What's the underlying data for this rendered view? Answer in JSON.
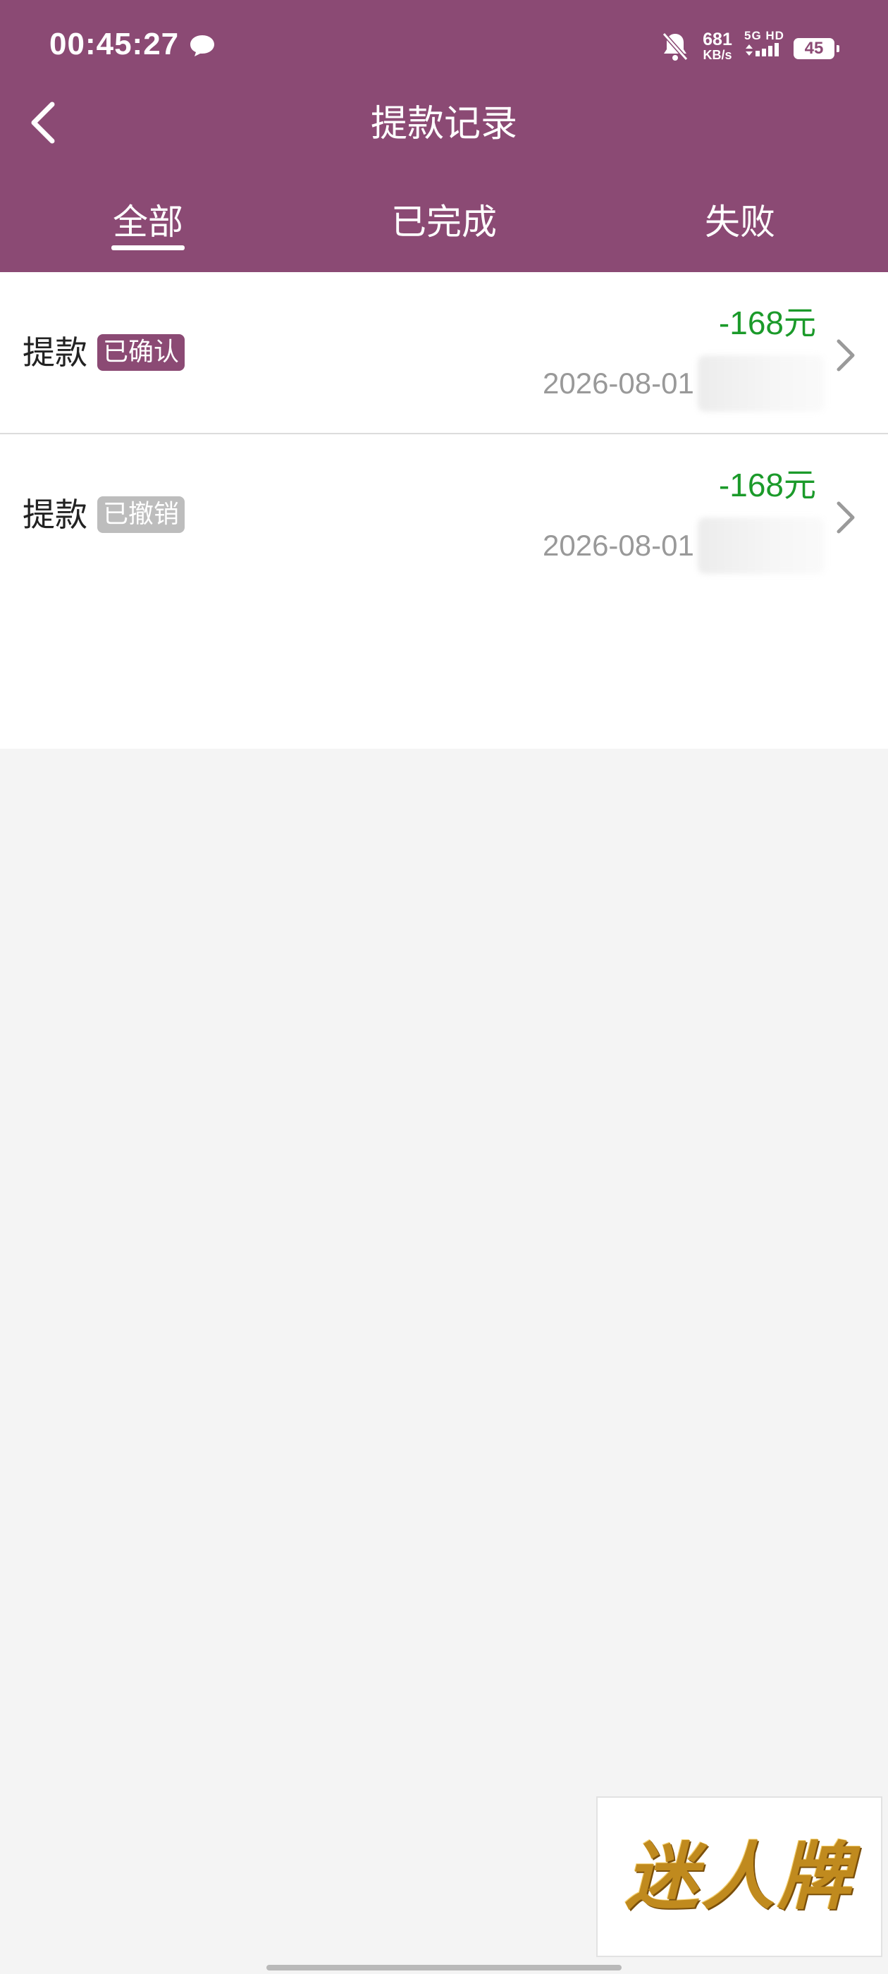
{
  "colors": {
    "accent": "#8b4a74",
    "amount_green": "#1b9a2a",
    "badge_cancelled": "#bdbdbd"
  },
  "status_bar": {
    "time": "00:45:27",
    "net_speed_value": "681",
    "net_speed_unit": "KB/s",
    "signal_label": "5G HD",
    "battery": "45"
  },
  "header": {
    "title": "提款记录"
  },
  "tabs": [
    {
      "label": "全部",
      "active": true
    },
    {
      "label": "已完成",
      "active": false
    },
    {
      "label": "失败",
      "active": false
    }
  ],
  "records": [
    {
      "kind": "提款",
      "status": "已确认",
      "amount": "-168元",
      "date": "2026-08-01"
    },
    {
      "kind": "提款",
      "status": "已撤销",
      "amount": "-168元",
      "date": "2026-08-01"
    }
  ],
  "logo": {
    "text": "迷人牌"
  },
  "icons": [
    "chat-bubble-icon",
    "bell-off-icon",
    "back-arrow-icon",
    "chevron-right-icon"
  ]
}
